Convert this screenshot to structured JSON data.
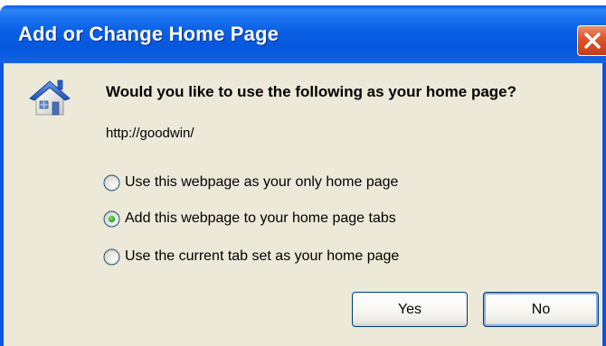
{
  "window": {
    "title": "Add or Change Home Page"
  },
  "dialog": {
    "icon": "home-icon",
    "question": "Would you like to use the following as your home page?",
    "url": "http://goodwin/",
    "options": [
      {
        "label": "Use this webpage as your only home page",
        "selected": false
      },
      {
        "label": "Add this webpage to your home page tabs",
        "selected": true
      },
      {
        "label": "Use the current tab set as your home page",
        "selected": false
      }
    ],
    "buttons": {
      "yes": "Yes",
      "no": "No"
    }
  },
  "colors": {
    "titlebar": "#0a5ce8",
    "client_background": "#ece9d8",
    "close_button": "#e0552b",
    "radio_selected": "#21a121"
  }
}
